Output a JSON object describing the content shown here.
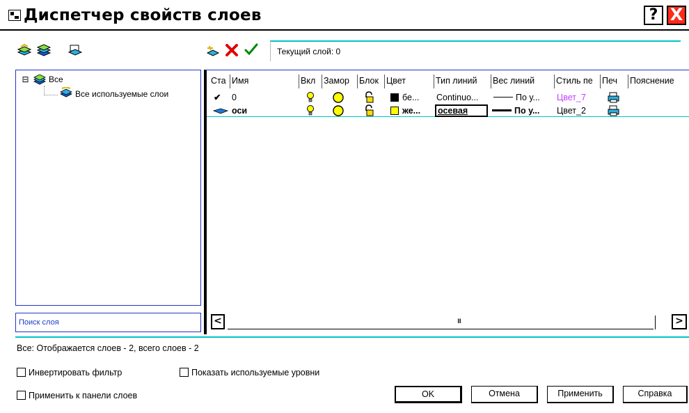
{
  "window": {
    "title": "Диспетчер свойств слоев",
    "help_label": "?",
    "close_label": "X"
  },
  "toolbar": {
    "current_layer_text": "Текущий слой: 0"
  },
  "tree": {
    "root_expander": "⊟",
    "root_label": "Все",
    "child_label": "Все используемые слои"
  },
  "search": {
    "placeholder": "Поиск слоя"
  },
  "grid": {
    "columns": [
      "Ста",
      "Имя",
      "Вкл",
      "Замор",
      "Блок",
      "Цвет",
      "Тип линий",
      "Вес линий",
      "Стиль пе",
      "Печ",
      "Пояснение"
    ],
    "rows": [
      {
        "status": "✔",
        "name": "0",
        "color_name": "бе...",
        "color": "#000000",
        "linetype": "Continuo...",
        "lineweight": "По у...",
        "plotstyle": "Цвет_7"
      },
      {
        "status": "➤",
        "name": "оси",
        "color_name": "же...",
        "color": "#ffff00",
        "linetype": "осевая",
        "lineweight": "По у...",
        "plotstyle": "Цвет_2"
      }
    ],
    "scroll_thumb": "III",
    "scroll_left": "<",
    "scroll_right": ">"
  },
  "status": {
    "text": "Все: Отображается слоев - 2, всего слоев - 2"
  },
  "options": {
    "invert_filter": "Инвертировать фильтр",
    "show_used": "Показать используемые уровни",
    "apply_to_toolbar": "Применить к панели слоев"
  },
  "buttons": {
    "ok": "OK",
    "cancel": "Отмена",
    "apply": "Применить",
    "help": "Справка"
  },
  "colors": {
    "accent_cyan": "#00c4c4",
    "panel_border": "#2233cc",
    "close_red": "#ff2a1a",
    "plotstyle_disabled": "#c040ff"
  }
}
